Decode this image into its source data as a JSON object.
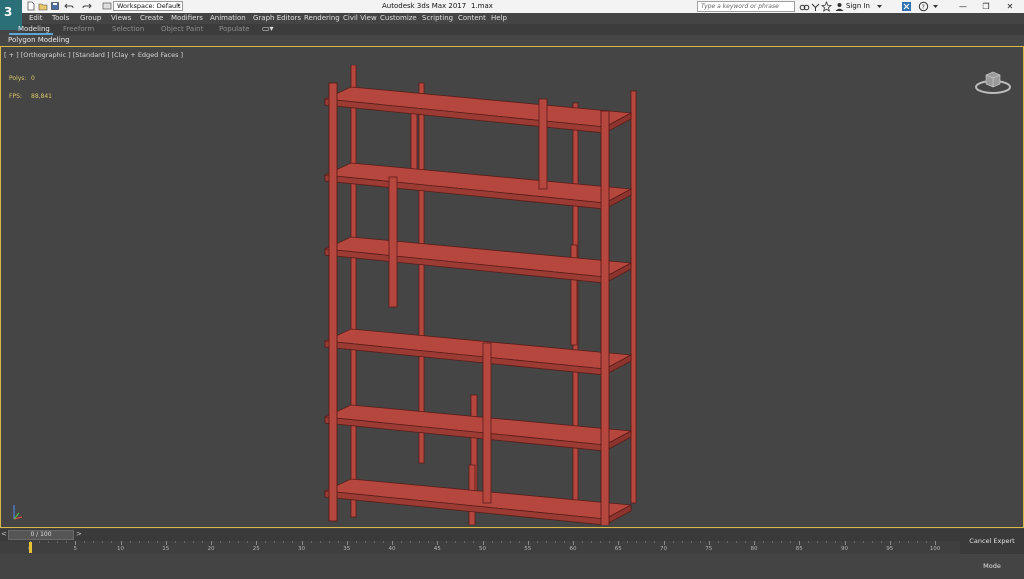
{
  "title_bar": {
    "workspace": "Workspace: Default",
    "app_title": "Autodesk 3ds Max 2017",
    "file_name": "1.max",
    "search_placeholder": "Type a keyword or phrase",
    "sign_in": "Sign In"
  },
  "menu": [
    "Edit",
    "Tools",
    "Group",
    "Views",
    "Create",
    "Modifiers",
    "Animation",
    "Graph Editors",
    "Rendering",
    "Civil View",
    "Customize",
    "Scripting",
    "Content",
    "Help"
  ],
  "ribbon": {
    "tabs": [
      "Modeling",
      "Freeform",
      "Selection",
      "Object Paint",
      "Populate"
    ],
    "active_tab": "Modeling",
    "panel": "Polygon Modeling"
  },
  "viewport": {
    "label": "[ + ] [Orthographic ] [Standard ] [Clay + Edged Faces ]",
    "stats": {
      "polys_label": "Polys:",
      "polys_value": "0",
      "fps_label": "FPS:",
      "fps_value": "88,841"
    },
    "object_color": "#b5473f"
  },
  "time_slider": {
    "frame": "0 / 100",
    "left_arrow": "<",
    "right_arrow": ">"
  },
  "track_ticks": [
    "0",
    "5",
    "10",
    "15",
    "20",
    "25",
    "30",
    "35",
    "40",
    "45",
    "50",
    "55",
    "60",
    "65",
    "70",
    "75",
    "80",
    "85",
    "90",
    "95",
    "100"
  ],
  "status": {
    "cancel_expert": "Cancel Expert Mode"
  },
  "colors": {
    "viewport_border": "#d9b846",
    "active_tab_underline": "#5aa6d8",
    "stats_text": "#d7c86a"
  }
}
